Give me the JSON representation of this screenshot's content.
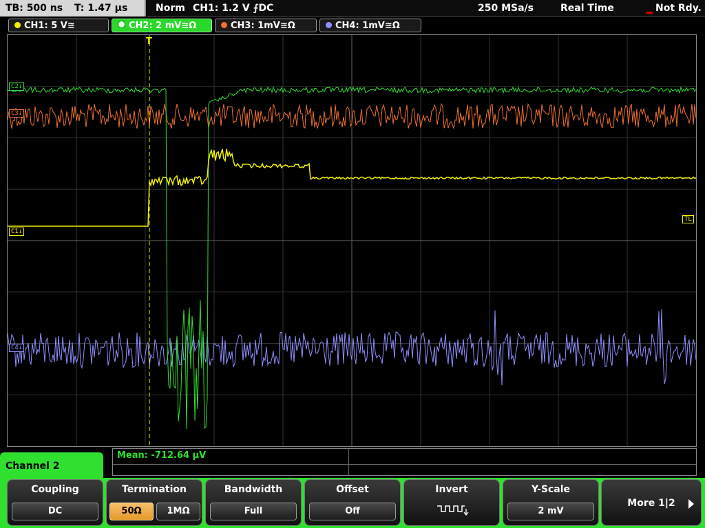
{
  "header": {
    "timebase": "TB: 500 ns",
    "trigger_pos": "T: 1.47 µs",
    "mode": "Norm",
    "trigger_info": "CH1: 1.2 V ⨍DC",
    "sample_rate": "250 MSa/s",
    "acq_mode": "Real Time",
    "status": "Not Rdy."
  },
  "channels": [
    {
      "label": "CH1: 5 V≅",
      "color": "#f0f000"
    },
    {
      "label": "CH2: 2 mV≅Ω",
      "color": "#2fe02f"
    },
    {
      "label": "CH3: 1mV≅Ω",
      "color": "#f07030"
    },
    {
      "label": "CH4: 1mV≅Ω",
      "color": "#9090ff"
    }
  ],
  "markers": {
    "c2": "C2↓",
    "c3": "C3↓",
    "c1": "C1↓",
    "c4": "C4↓",
    "tl": "TL",
    "trigger": "T"
  },
  "measurement": {
    "text": "Mean: -712.64 µV"
  },
  "menu": {
    "title": "Channel 2",
    "coupling": {
      "title": "Coupling",
      "value": "DC"
    },
    "termination": {
      "title": "Termination",
      "opt1": "50Ω",
      "opt2": "1MΩ"
    },
    "bandwidth": {
      "title": "Bandwidth",
      "value": "Full"
    },
    "offset": {
      "title": "Offset",
      "value": "Off"
    },
    "invert": {
      "title": "Invert"
    },
    "yscale": {
      "title": "Y-Scale",
      "value": "2 mV"
    },
    "more": {
      "label": "More 1|2"
    }
  }
}
